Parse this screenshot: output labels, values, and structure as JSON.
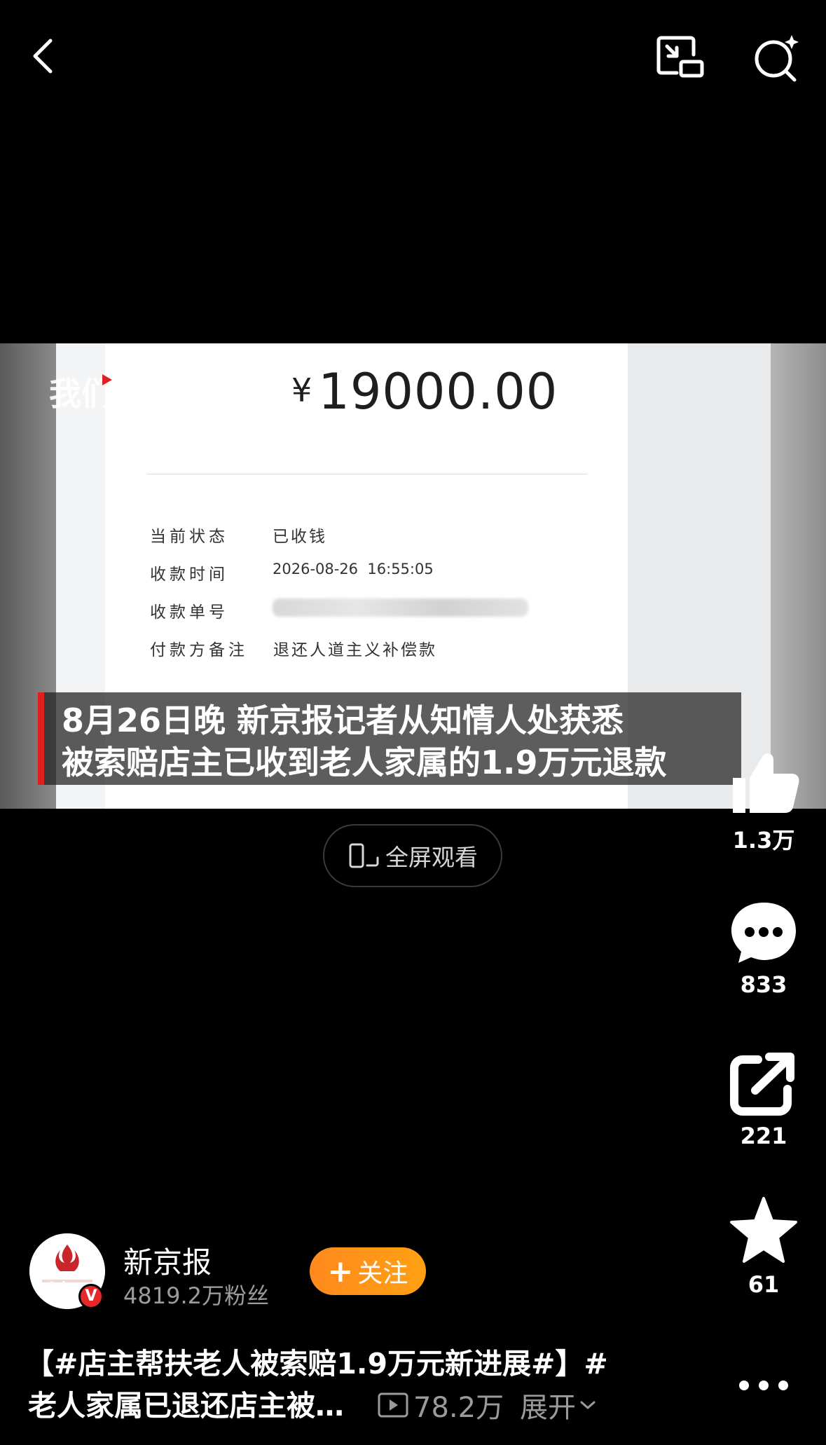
{
  "topbar": {
    "back_icon": "chevron-left-icon",
    "pip_icon": "picture-in-picture-icon",
    "search_icon": "search-sparkle-icon"
  },
  "video": {
    "watermark": "我们",
    "receipt": {
      "currency": "¥",
      "amount": "19000.00",
      "rows": [
        {
          "label": "当前状态",
          "value": "已收钱"
        },
        {
          "label": "收款时间",
          "value": "2026-08-26  16:55:05"
        },
        {
          "label": "收款单号",
          "value": ""
        },
        {
          "label": "付款方备注",
          "value": "退还人道主义补偿款"
        }
      ]
    },
    "subtitle_line1": "8月26日晚 新京报记者从知情人处获悉",
    "subtitle_line2": "被索赔店主已收到老人家属的1.9万元退款"
  },
  "fullscreen_label": "全屏观看",
  "actions": {
    "like_count": "1.3万",
    "comment_count": "833",
    "share_count": "221",
    "favorite_count": "61"
  },
  "author": {
    "name": "新京报",
    "avatar_text": "新京",
    "badge": "V",
    "followers": "4819.2万粉丝",
    "follow_label": "关注"
  },
  "caption": {
    "line1": "【#店主帮扶老人被索赔1.9万元新进展#】#",
    "line2": "老人家属已退还店主被…",
    "views": "78.2万",
    "expand": "展开"
  }
}
